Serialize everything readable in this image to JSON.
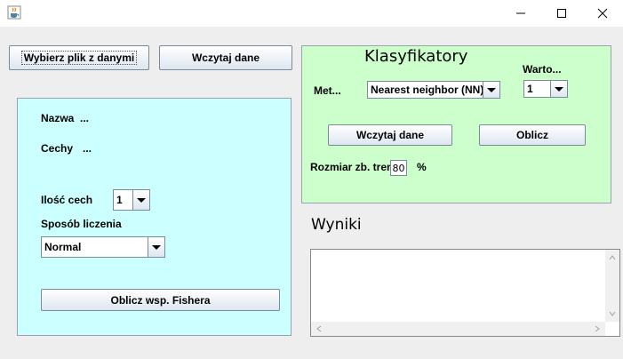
{
  "window": {
    "app_icon": "java-cup-icon",
    "controls": [
      "minimize-icon",
      "maximize-icon",
      "close-icon"
    ]
  },
  "top_buttons": {
    "choose_file": "Wybierz plik z danymi",
    "load_data": "Wczytaj dane"
  },
  "left_panel": {
    "bg": "#ccffff",
    "name_label": "Nazwa",
    "name_value": "...",
    "features_label": "Cechy",
    "features_value": "...",
    "feature_count_label": "Ilość cech",
    "feature_count_value": "1",
    "method_label": "Sposób liczenia",
    "method_value": "Normal",
    "fisher_button": "Oblicz wsp. Fishera"
  },
  "classifiers_panel": {
    "bg": "#ccffcc",
    "title": "Klasyfikatory",
    "method_label": "Met...",
    "method_value": "Nearest neighbor (NN)",
    "value_label": "Warto...",
    "value_value": "1",
    "load_button": "Wczytaj dane",
    "compute_button": "Oblicz",
    "train_size_label": "Rozmiar zb. tren",
    "train_size_value": "80",
    "percent": "%"
  },
  "results": {
    "title": "Wyniki",
    "text": ""
  }
}
